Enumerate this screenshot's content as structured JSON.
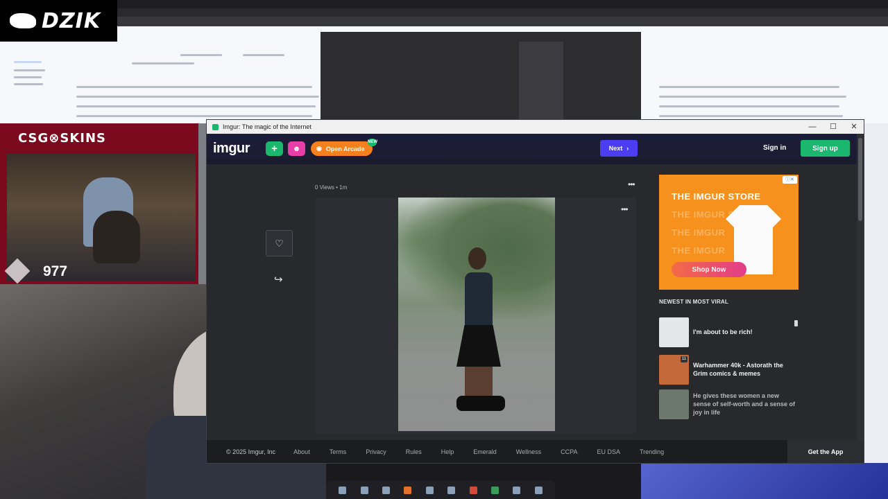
{
  "overlay": {
    "channel_logo": "DZIK",
    "sponsor": "CSG⊗SKINS",
    "counter": "977"
  },
  "window": {
    "title": "Imgur: The magic of the Internet",
    "minimize": "—",
    "maximize": "☐",
    "close": "✕"
  },
  "header": {
    "logo": "imgur",
    "upload_icon": "plus-icon",
    "arcade_label": "Open Arcade",
    "arcade_badge": "NEW",
    "next_label": "Next",
    "signin_label": "Sign in",
    "signup_label": "Sign up"
  },
  "post": {
    "meta": "0 Views • 1m",
    "menu": "•••",
    "image_menu": "•••",
    "fav_icon": "♡",
    "share_icon": "↪"
  },
  "ad": {
    "close_label": "ⓘ✕",
    "title": "THE IMGUR STORE",
    "ghost_1": "THE IMGUR STORE",
    "ghost_2": "THE IMGUR",
    "ghost_3": "THE IMGUR",
    "shop_label": "Shop Now"
  },
  "sidebar": {
    "heading": "NEWEST IN MOST VIRAL",
    "items": [
      {
        "title": "I'm about to be rich!"
      },
      {
        "title": "Warhammer 40k - Astorath the Grim comics & memes",
        "badge": "11"
      },
      {
        "title": "He gives these women a new sense of self-worth and a sense of joy in life"
      }
    ]
  },
  "footer": {
    "copyright": "© 2025 Imgur, Inc",
    "links": [
      "About",
      "Terms",
      "Privacy",
      "Rules",
      "Help",
      "Emerald",
      "Wellness",
      "CCPA",
      "EU DSA",
      "Trending"
    ],
    "get_app": "Get the App"
  },
  "colors": {
    "imgur_green": "#1bb76e",
    "next_purple": "#4a3df2",
    "arcade_orange": "#f5811e",
    "ad_orange": "#f7911e",
    "frame_red": "#7b0a1e"
  }
}
